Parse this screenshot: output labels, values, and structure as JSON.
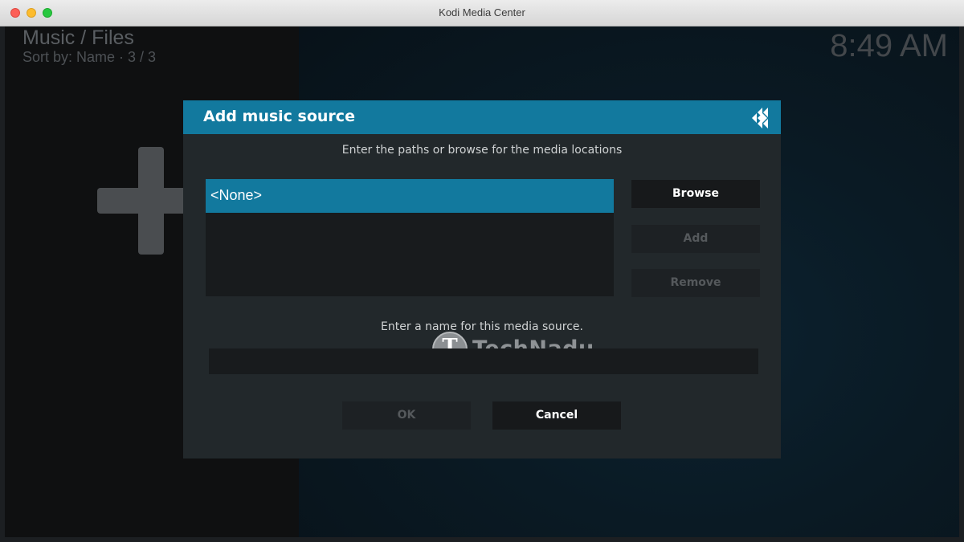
{
  "window": {
    "title": "Kodi Media Center"
  },
  "header": {
    "title": "Music / Files",
    "sort": "Sort by: Name  ·  3 / 3",
    "clock": "8:49 AM"
  },
  "dialog": {
    "title": "Add music source",
    "paths_prompt": "Enter the paths or browse for the media locations",
    "paths": [
      "<None>"
    ],
    "browse_label": "Browse",
    "add_label": "Add",
    "remove_label": "Remove",
    "name_prompt": "Enter a name for this media source.",
    "name_value": "",
    "ok_label": "OK",
    "cancel_label": "Cancel",
    "accent_color": "#12799e"
  },
  "watermark": {
    "letter": "T",
    "text": "TechNadu"
  },
  "icons": {
    "kodi": "kodi-logo-icon",
    "add": "plus-icon"
  }
}
